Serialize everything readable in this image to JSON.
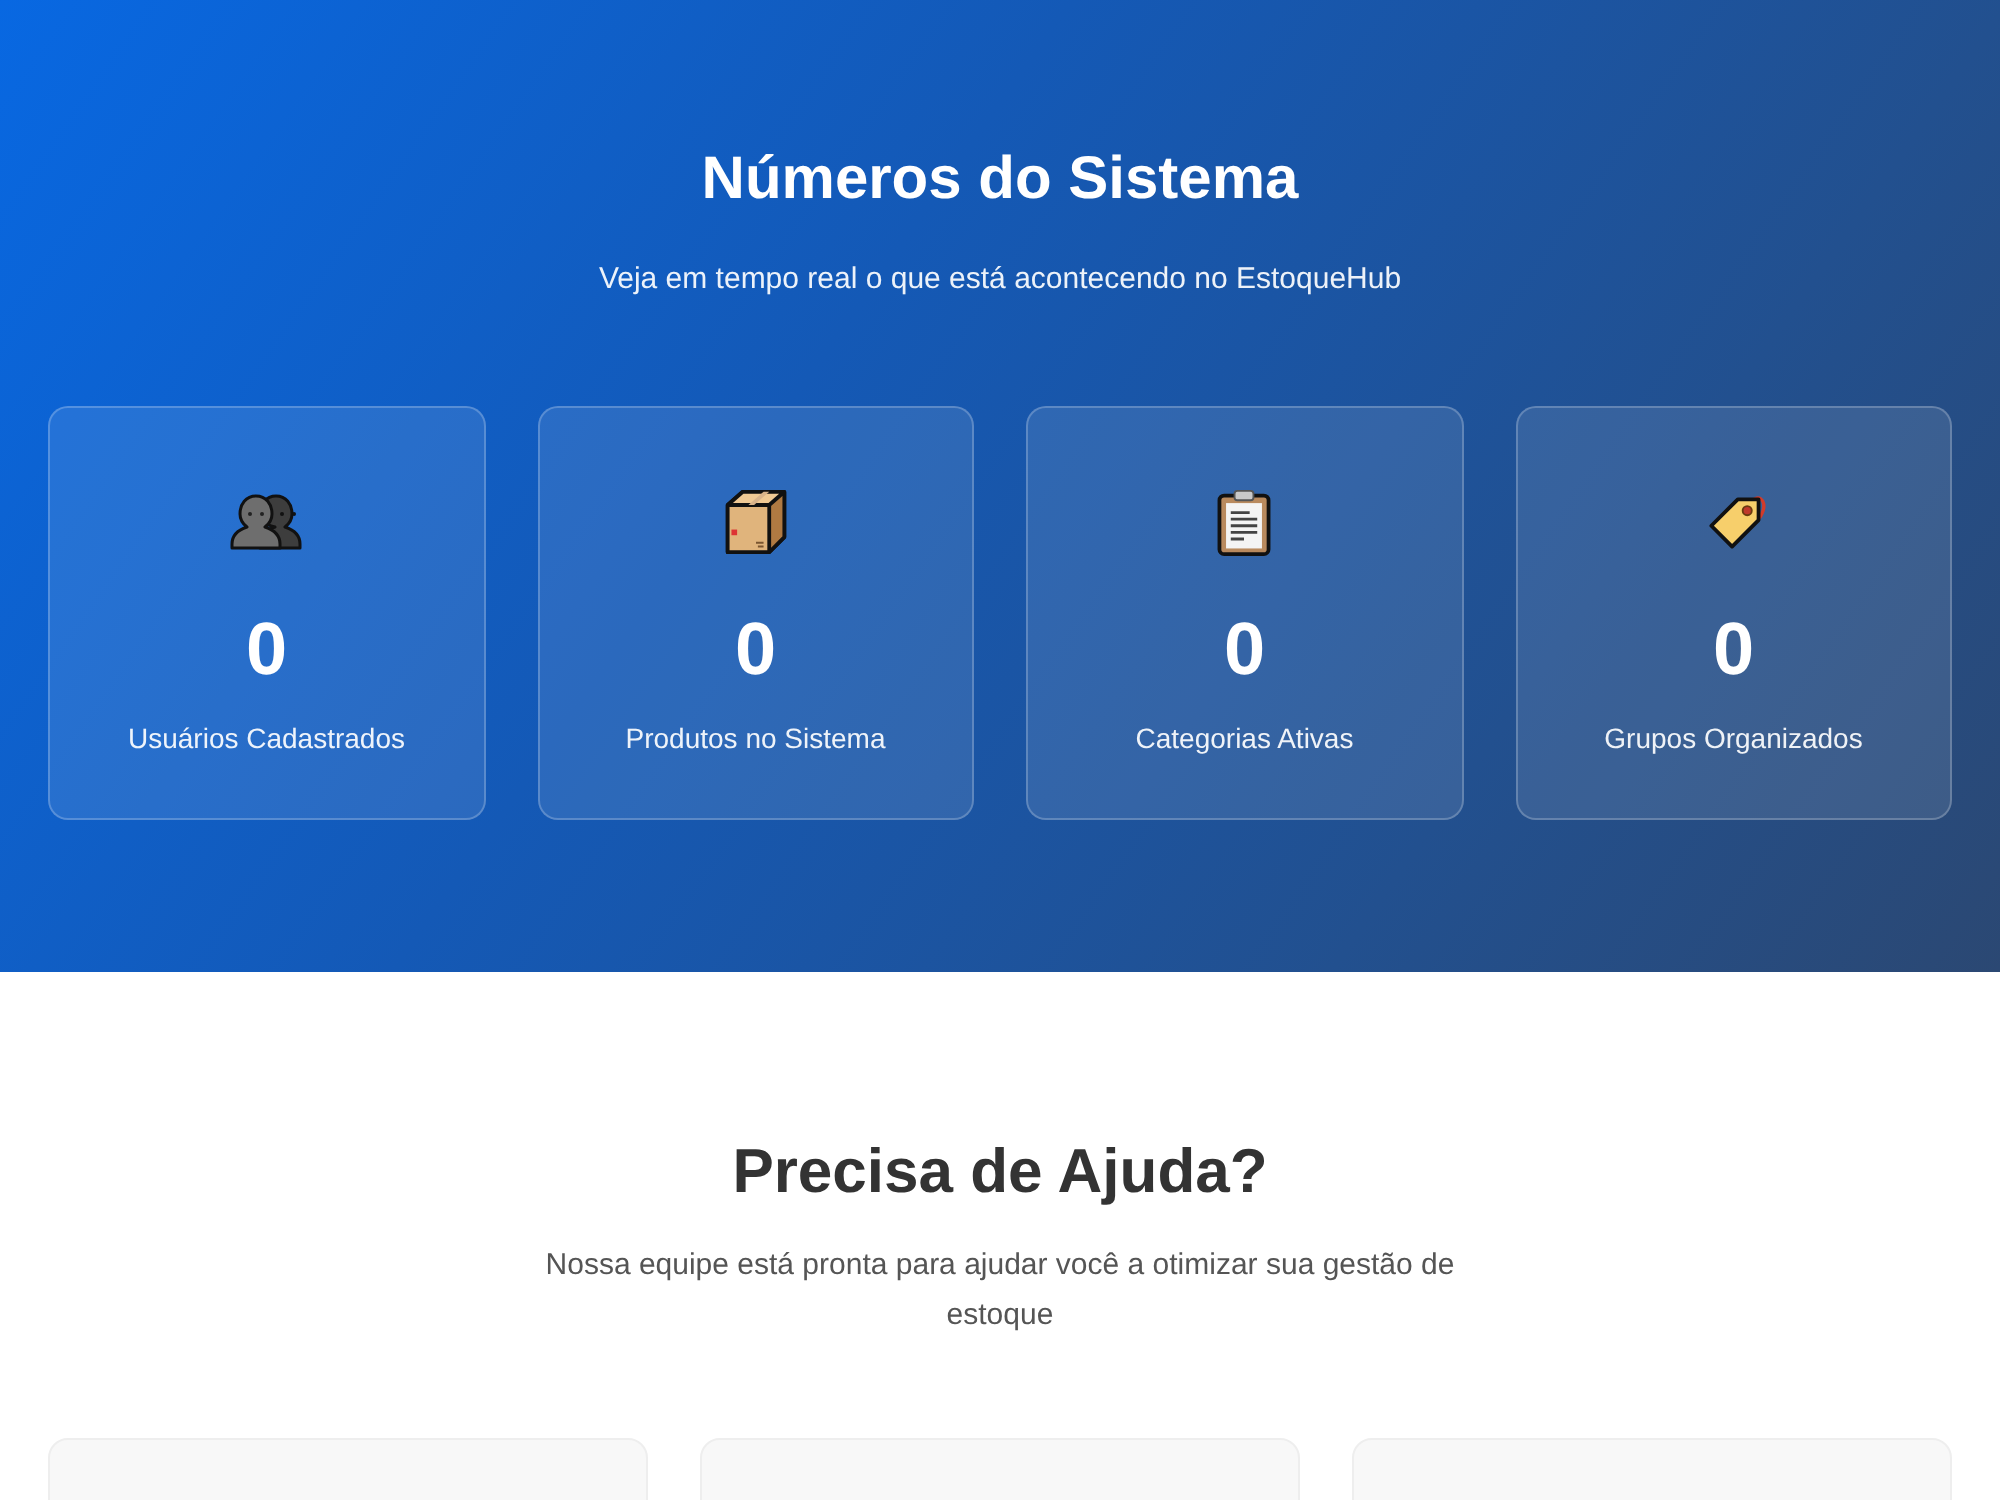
{
  "hero": {
    "title": "Números do Sistema",
    "subtitle": "Veja em tempo real o que está acontecendo no EstoqueHub"
  },
  "stats": [
    {
      "value": "0",
      "label": "Usuários Cadastrados"
    },
    {
      "value": "0",
      "label": "Produtos no Sistema"
    },
    {
      "value": "0",
      "label": "Categorias Ativas"
    },
    {
      "value": "0",
      "label": "Grupos Organizados"
    }
  ],
  "help": {
    "title": "Precisa de Ajuda?",
    "text": "Nossa equipe está pronta para ajudar você a otimizar sua gestão de estoque"
  }
}
